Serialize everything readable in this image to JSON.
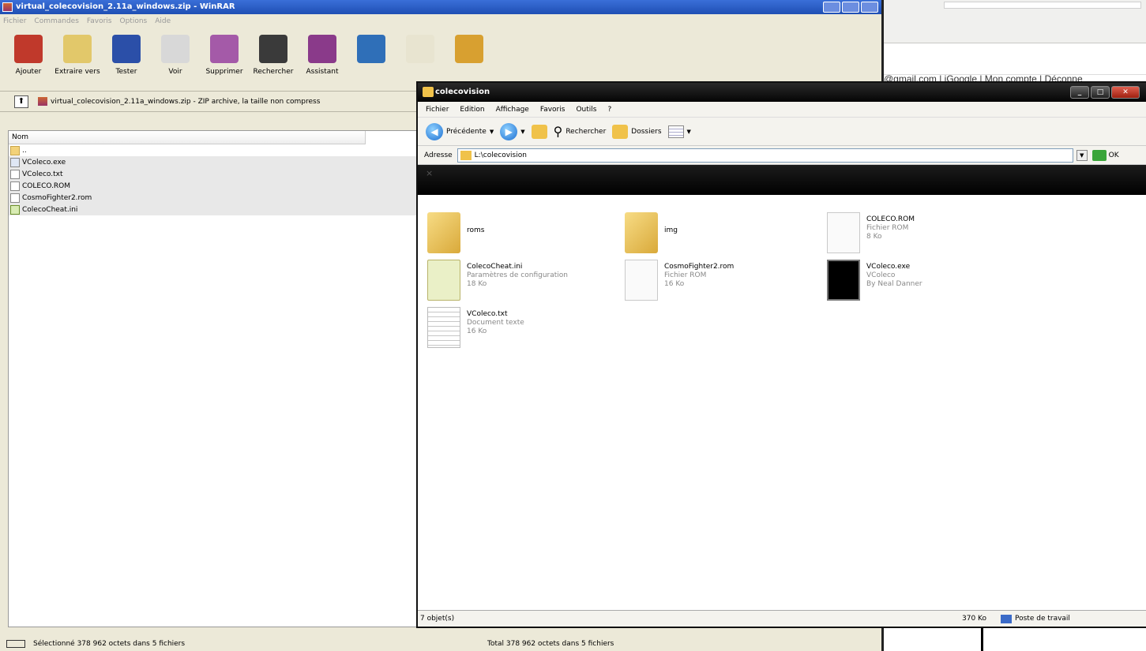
{
  "winrar": {
    "title": "virtual_colecovision_2.11a_windows.zip - WinRAR",
    "menu": [
      "Fichier",
      "Commandes",
      "Favoris",
      "Options",
      "Aide"
    ],
    "toolbar": [
      {
        "label": "Ajouter",
        "icon": "add-archive-icon",
        "color": "#c0392b"
      },
      {
        "label": "Extraire vers",
        "icon": "extract-icon",
        "color": "#e2c86a"
      },
      {
        "label": "Tester",
        "icon": "test-icon",
        "color": "#2b4fa8"
      },
      {
        "label": "Voir",
        "icon": "view-icon",
        "color": "#d8d8d8"
      },
      {
        "label": "Supprimer",
        "icon": "delete-icon",
        "color": "#a45aa8"
      },
      {
        "label": "Rechercher",
        "icon": "binoculars-icon",
        "color": "#3a3a3a"
      },
      {
        "label": "Assistant",
        "icon": "wizard-icon",
        "color": "#8a3a8a"
      },
      {
        "label": "",
        "icon": "info-icon",
        "color": "#2f6fb8"
      },
      {
        "label": "",
        "icon": "comment-icon",
        "color": "#e8e4d0"
      },
      {
        "label": "",
        "icon": "sfx-icon",
        "color": "#d8a030"
      }
    ],
    "path": "virtual_colecovision_2.11a_windows.zip - ZIP archive, la taille non compress",
    "column_name": "Nom",
    "files": [
      {
        "name": "..",
        "icon": "folder",
        "selected": false
      },
      {
        "name": "VColeco.exe",
        "icon": "exe",
        "selected": true
      },
      {
        "name": "VColeco.txt",
        "icon": "txt",
        "selected": true
      },
      {
        "name": "COLECO.ROM",
        "icon": "rom",
        "selected": true
      },
      {
        "name": "CosmoFighter2.rom",
        "icon": "rom",
        "selected": true
      },
      {
        "name": "ColecoCheat.ini",
        "icon": "ini",
        "selected": true
      }
    ],
    "status_left": "Sélectionné 378 962 octets dans 5 fichiers",
    "status_right": "Total 378 962 octets dans 5 fichiers"
  },
  "explorer": {
    "title": "colecovision",
    "menu": [
      "Fichier",
      "Edition",
      "Affichage",
      "Favoris",
      "Outils",
      "?"
    ],
    "nav": {
      "back": "Précédente",
      "search": "Rechercher",
      "folders": "Dossiers"
    },
    "address_label": "Adresse",
    "address": "L:\\colecovision",
    "go": "OK",
    "band_glyph": "×",
    "items": [
      {
        "name": "roms",
        "line2": "",
        "line3": "",
        "kind": "folder"
      },
      {
        "name": "img",
        "line2": "",
        "line3": "",
        "kind": "folder"
      },
      {
        "name": "COLECO.ROM",
        "line2": "Fichier ROM",
        "line3": "8 Ko",
        "kind": "doc"
      },
      {
        "name": "ColecoCheat.ini",
        "line2": "Paramètres de configuration",
        "line3": "18 Ko",
        "kind": "ini"
      },
      {
        "name": "CosmoFighter2.rom",
        "line2": "Fichier ROM",
        "line3": "16 Ko",
        "kind": "doc"
      },
      {
        "name": "VColeco.exe",
        "line2": "VColeco",
        "line3": "By Neal Danner",
        "kind": "exe"
      },
      {
        "name": "VColeco.txt",
        "line2": "Document texte",
        "line3": "16 Ko",
        "kind": "txt"
      }
    ],
    "status_count": "7 objet(s)",
    "status_size": "370 Ko",
    "status_location": "Poste de travail"
  },
  "background": {
    "links": "@gmail.com | iGoogle | Mon compte | Déconne"
  }
}
